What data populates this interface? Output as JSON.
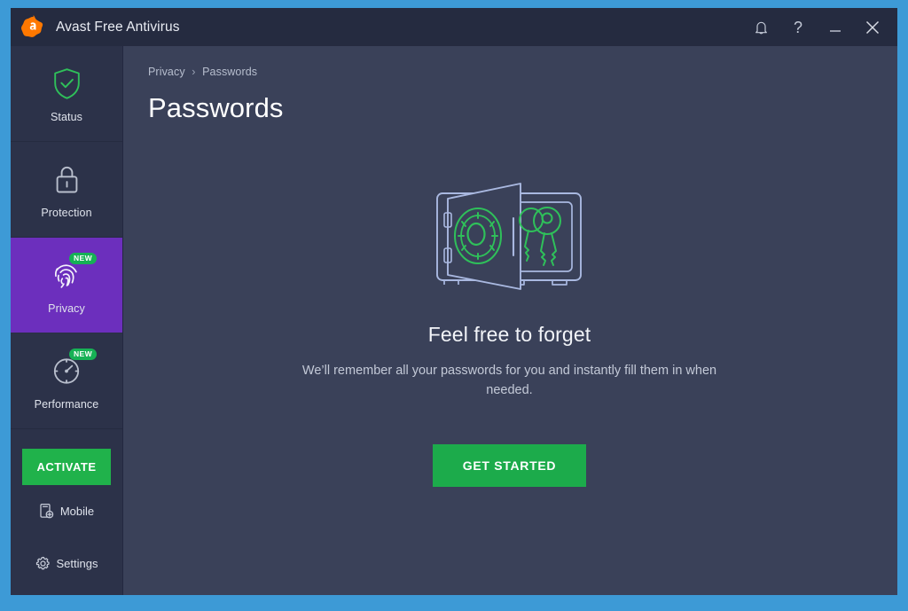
{
  "window": {
    "title": "Avast Free Antivirus",
    "logo_icon": "avast-logo-icon",
    "controls": [
      {
        "name": "notifications-bell-icon",
        "label": "Notifications"
      },
      {
        "name": "help-question-icon",
        "label": "Help"
      },
      {
        "name": "minimize-icon",
        "label": "Minimize"
      },
      {
        "name": "close-icon",
        "label": "Close"
      }
    ]
  },
  "sidebar": {
    "items": [
      {
        "label": "Status",
        "icon": "shield-check-icon",
        "badge": null,
        "active": false
      },
      {
        "label": "Protection",
        "icon": "padlock-icon",
        "badge": null,
        "active": false
      },
      {
        "label": "Privacy",
        "icon": "fingerprint-icon",
        "badge": "NEW",
        "active": true
      },
      {
        "label": "Performance",
        "icon": "speedometer-icon",
        "badge": "NEW",
        "active": false
      }
    ],
    "activate_label": "ACTIVATE",
    "mobile_label": "Mobile",
    "mobile_icon": "mobile-phone-add-icon",
    "settings_label": "Settings",
    "settings_icon": "gear-icon"
  },
  "content": {
    "breadcrumb": {
      "parent": "Privacy",
      "separator": "›",
      "current": "Passwords"
    },
    "page_title": "Passwords",
    "illustration_icon": "open-safe-with-keys-icon",
    "hero_heading": "Feel free to forget",
    "hero_text": "We’ll remember all your passwords for you and instantly fill them in when needed.",
    "cta_label": "GET STARTED"
  },
  "colors": {
    "desktop_blue": "#3d9ad6",
    "window_dark": "#343b54",
    "titlebar": "#252b40",
    "sidebar": "#2c3249",
    "content_bg": "#3a4159",
    "active_purple": "#6c2fbd",
    "accent_green": "#1cab4b",
    "badge_green": "#16b155",
    "avast_orange": "#ff7800",
    "illustration_outline": "#a9b8e0",
    "illustration_green": "#2fc05a"
  }
}
